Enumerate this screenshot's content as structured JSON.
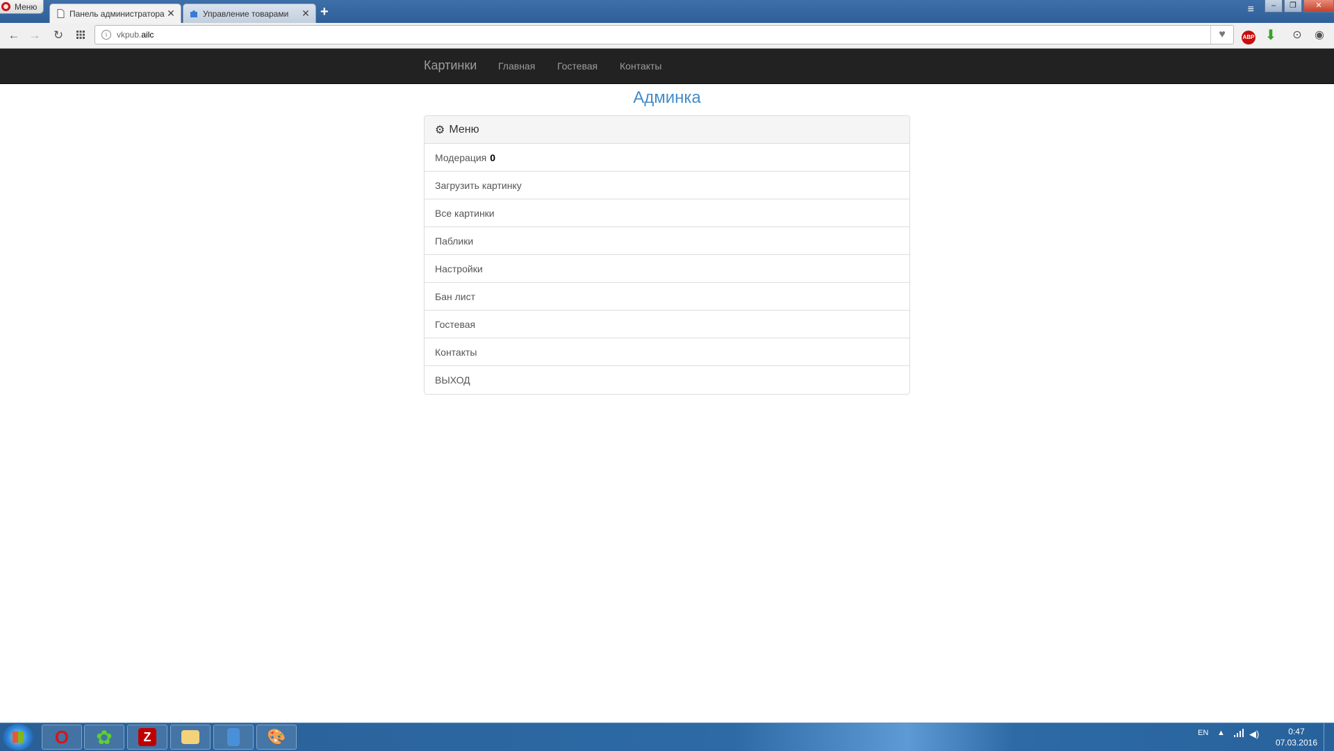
{
  "browser": {
    "menu_label": "Меню",
    "tabs": [
      {
        "title": "Панель администратора (А",
        "close": "✕"
      },
      {
        "title": "Управление товарами",
        "close": "✕"
      }
    ],
    "new_tab": "+",
    "address": {
      "subdomain": "vkpub.",
      "domain": "ailc"
    }
  },
  "site": {
    "brand": "Картинки",
    "nav": [
      {
        "label": "Главная"
      },
      {
        "label": "Гостевая"
      },
      {
        "label": "Контакты"
      }
    ],
    "page_title": "Админка"
  },
  "panel": {
    "heading": "Меню",
    "items": [
      {
        "label": "Модерация",
        "count": "0"
      },
      {
        "label": "Загрузить картинку"
      },
      {
        "label": "Все картинки"
      },
      {
        "label": "Паблики"
      },
      {
        "label": "Настройки"
      },
      {
        "label": "Бан лист"
      },
      {
        "label": "Гостевая"
      },
      {
        "label": "Контакты"
      },
      {
        "label": "ВЫХОД"
      }
    ]
  },
  "taskbar": {
    "language": "EN",
    "time": "0:47",
    "date": "07.03.2016"
  },
  "colors": {
    "navbar_bg": "#222222",
    "link_blue": "#428bca",
    "panel_heading_bg": "#f5f5f5"
  }
}
